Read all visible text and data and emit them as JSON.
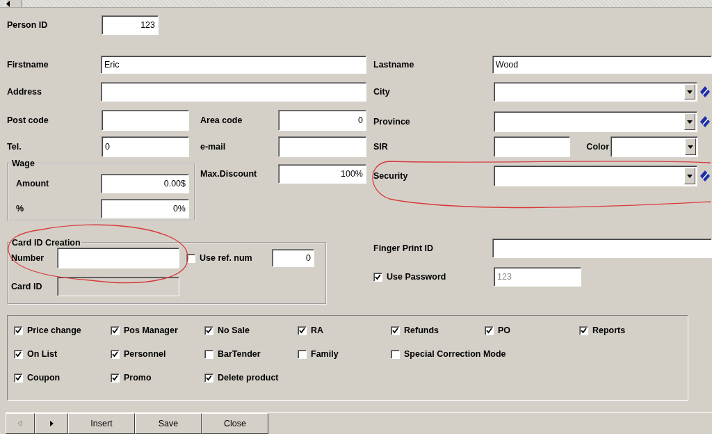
{
  "person_id": {
    "label": "Person ID",
    "value": "123"
  },
  "firstname": {
    "label": "Firstname",
    "value": "Eric"
  },
  "address": {
    "label": "Address"
  },
  "post_code": {
    "label": "Post code"
  },
  "area_code": {
    "label": "Area code",
    "value": "0"
  },
  "tel": {
    "label": "Tel.",
    "value": "0"
  },
  "email": {
    "label": "e-mail"
  },
  "wage": {
    "title": "Wage",
    "amount": {
      "label": "Amount",
      "value": "0.00$"
    },
    "percent": {
      "label": "%",
      "value": "0%"
    }
  },
  "max_discount": {
    "label": "Max.Discount",
    "value": "100%"
  },
  "card_id_creation": {
    "title": "Card ID Creation",
    "number": {
      "label": "Number"
    },
    "use_ref_num": {
      "label": "Use ref. num",
      "checked": false,
      "value": "0"
    },
    "card_id": {
      "label": "Card ID",
      "disabled": true
    }
  },
  "lastname": {
    "label": "Lastname",
    "value": "Wood"
  },
  "city": {
    "label": "City",
    "kind": "combo-lookup"
  },
  "province": {
    "label": "Province",
    "kind": "combo-lookup"
  },
  "sir": {
    "label": "SIR"
  },
  "color": {
    "label": "Color",
    "kind": "combo"
  },
  "security": {
    "label": "Security",
    "kind": "combo-lookup"
  },
  "finger_print_id": {
    "label": "Finger Print ID"
  },
  "use_password": {
    "label": "Use Password",
    "checked": true,
    "value": "123",
    "disabled": true
  },
  "permissions": [
    {
      "items": [
        {
          "label": "Price change",
          "checked": true
        },
        {
          "label": "Pos Manager",
          "checked": true
        },
        {
          "label": "No Sale",
          "checked": true
        },
        {
          "label": "RA",
          "checked": true
        },
        {
          "label": "Refunds",
          "checked": true
        },
        {
          "label": "PO",
          "checked": true
        },
        {
          "label": "Reports",
          "checked": true
        }
      ]
    },
    {
      "items": [
        {
          "label": "On List",
          "checked": true
        },
        {
          "label": "Personnel",
          "checked": true
        },
        {
          "label": "BarTender",
          "checked": false
        },
        {
          "label": "Family",
          "checked": false
        },
        {
          "label": "Special Correction Mode",
          "checked": false
        }
      ]
    },
    {
      "items": [
        {
          "label": "Coupon",
          "checked": true
        },
        {
          "label": "Promo",
          "checked": true
        },
        {
          "label": "Delete product",
          "checked": true
        }
      ]
    }
  ],
  "nav": {
    "previous": {
      "disabled": true
    },
    "next": {
      "disabled": false
    }
  },
  "buttons": [
    {
      "label": "Insert"
    },
    {
      "label": "Save"
    },
    {
      "label": "Close"
    }
  ]
}
